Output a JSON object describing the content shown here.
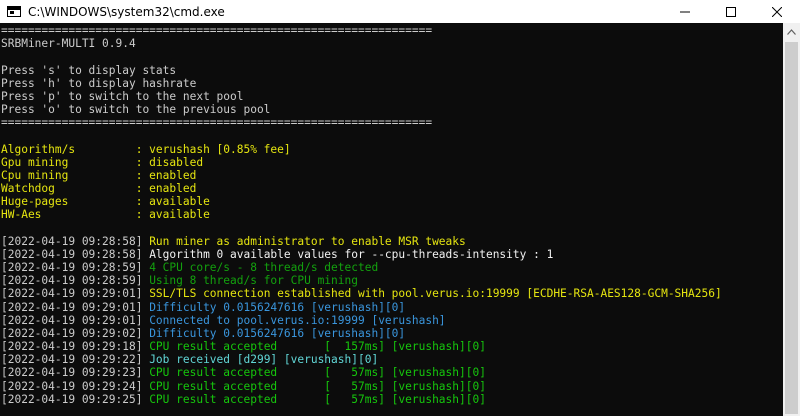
{
  "window": {
    "title": "C:\\WINDOWS\\system32\\cmd.exe",
    "icons": {
      "app": "console-app-icon",
      "minimize": "minimize-icon",
      "maximize": "maximize-icon",
      "close": "close-icon",
      "scroll_up": "scroll-up-arrow-icon"
    }
  },
  "colors": {
    "default": "#cccccc",
    "yellow": "#f9f1a5",
    "gold": "#e5e510",
    "green": "#16c60c",
    "cyan": "#3a96dd",
    "bright_cyan": "#61d6d6",
    "white": "#f2f2f2"
  },
  "console": {
    "lines": [
      {
        "parts": [
          {
            "text": "================================================================",
            "color": "#cccccc"
          }
        ]
      },
      {
        "parts": [
          {
            "text": "SRBMiner-MULTI 0.9.4",
            "color": "#cccccc"
          }
        ]
      },
      {
        "parts": [
          {
            "text": "",
            "color": "#cccccc"
          }
        ]
      },
      {
        "parts": [
          {
            "text": "Press 's' to display stats",
            "color": "#cccccc"
          }
        ]
      },
      {
        "parts": [
          {
            "text": "Press 'h' to display hashrate",
            "color": "#cccccc"
          }
        ]
      },
      {
        "parts": [
          {
            "text": "Press 'p' to switch to the next pool",
            "color": "#cccccc"
          }
        ]
      },
      {
        "parts": [
          {
            "text": "Press 'o' to switch to the previous pool",
            "color": "#cccccc"
          }
        ]
      },
      {
        "parts": [
          {
            "text": "================================================================",
            "color": "#cccccc"
          }
        ]
      },
      {
        "parts": [
          {
            "text": "",
            "color": "#cccccc"
          }
        ]
      },
      {
        "parts": [
          {
            "text": "Algorithm/s         : verushash [0.85% fee]",
            "color": "#e5e510"
          }
        ]
      },
      {
        "parts": [
          {
            "text": "Gpu mining          : disabled",
            "color": "#e5e510"
          }
        ]
      },
      {
        "parts": [
          {
            "text": "Cpu mining          : enabled",
            "color": "#e5e510"
          }
        ]
      },
      {
        "parts": [
          {
            "text": "Watchdog            : enabled",
            "color": "#e5e510"
          }
        ]
      },
      {
        "parts": [
          {
            "text": "Huge-pages          : available",
            "color": "#e5e510"
          }
        ]
      },
      {
        "parts": [
          {
            "text": "HW-Aes              : available",
            "color": "#e5e510"
          }
        ]
      },
      {
        "parts": [
          {
            "text": "",
            "color": "#cccccc"
          }
        ]
      },
      {
        "parts": [
          {
            "text": "[2022-04-19 09:28:58] ",
            "color": "#cccccc"
          },
          {
            "text": "Run miner as administrator to enable MSR tweaks",
            "color": "#e5e510"
          }
        ]
      },
      {
        "parts": [
          {
            "text": "[2022-04-19 09:28:58] ",
            "color": "#cccccc"
          },
          {
            "text": "Algorithm 0 available values for --cpu-threads-intensity : 1",
            "color": "#f2f2f2"
          }
        ]
      },
      {
        "parts": [
          {
            "text": "[2022-04-19 09:28:59] ",
            "color": "#cccccc"
          },
          {
            "text": "4 CPU core/s - 8 thread/s detected",
            "color": "#13a10e"
          }
        ]
      },
      {
        "parts": [
          {
            "text": "[2022-04-19 09:28:59] ",
            "color": "#cccccc"
          },
          {
            "text": "Using 8 thread/s for CPU mining",
            "color": "#13a10e"
          }
        ]
      },
      {
        "parts": [
          {
            "text": "[2022-04-19 09:29:01] ",
            "color": "#cccccc"
          },
          {
            "text": "SSL/TLS connection established with pool.verus.io:19999 [ECDHE-RSA-AES128-GCM-SHA256]",
            "color": "#e5e510"
          }
        ]
      },
      {
        "parts": [
          {
            "text": "[2022-04-19 09:29:01] ",
            "color": "#cccccc"
          },
          {
            "text": "Difficulty 0.0156247616 [verushash][0]",
            "color": "#3a96dd"
          }
        ]
      },
      {
        "parts": [
          {
            "text": "[2022-04-19 09:29:01] ",
            "color": "#cccccc"
          },
          {
            "text": "Connected to pool.verus.io:19999 [verushash]",
            "color": "#3a96dd"
          }
        ]
      },
      {
        "parts": [
          {
            "text": "[2022-04-19 09:29:02] ",
            "color": "#cccccc"
          },
          {
            "text": "Difficulty 0.0156247616 [verushash][0]",
            "color": "#3a96dd"
          }
        ]
      },
      {
        "parts": [
          {
            "text": "[2022-04-19 09:29:18] ",
            "color": "#cccccc"
          },
          {
            "text": "CPU result accepted       [  157ms] [verushash][0]",
            "color": "#16c60c"
          }
        ]
      },
      {
        "parts": [
          {
            "text": "[2022-04-19 09:29:22] ",
            "color": "#cccccc"
          },
          {
            "text": "Job received [d299] [verushash][0]",
            "color": "#61d6d6"
          }
        ]
      },
      {
        "parts": [
          {
            "text": "[2022-04-19 09:29:23] ",
            "color": "#cccccc"
          },
          {
            "text": "CPU result accepted       [   57ms] [verushash][0]",
            "color": "#16c60c"
          }
        ]
      },
      {
        "parts": [
          {
            "text": "[2022-04-19 09:29:24] ",
            "color": "#cccccc"
          },
          {
            "text": "CPU result accepted       [   57ms] [verushash][0]",
            "color": "#16c60c"
          }
        ]
      },
      {
        "parts": [
          {
            "text": "[2022-04-19 09:29:25] ",
            "color": "#cccccc"
          },
          {
            "text": "CPU result accepted       [   57ms] [verushash][0]",
            "color": "#16c60c"
          }
        ]
      }
    ]
  }
}
